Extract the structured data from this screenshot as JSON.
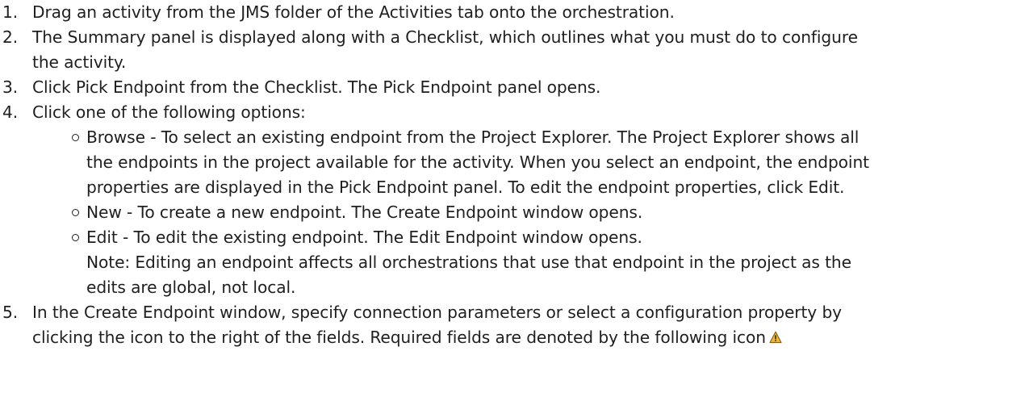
{
  "steps": [
    {
      "number": "1.",
      "text": "Drag an activity from the JMS folder of the Activities tab onto the orchestration."
    },
    {
      "number": "2.",
      "text_line1": "The Summary panel is displayed along with a Checklist, which outlines what you must do to configure",
      "text_line2": "the activity."
    },
    {
      "number": "3.",
      "text": "Click Pick Endpoint from the Checklist. The Pick Endpoint panel opens."
    },
    {
      "number": "4.",
      "text": "Click one of the following options:",
      "options": [
        {
          "line1": "Browse - To select an existing endpoint from the Project Explorer. The Project Explorer shows all",
          "line2": "the endpoints in the project available for the activity. When you select an endpoint, the endpoint",
          "line3": "properties are displayed in the Pick Endpoint panel. To edit the endpoint properties, click Edit."
        },
        {
          "line1": "New - To create a new endpoint. The Create Endpoint window opens."
        },
        {
          "line1": "Edit - To edit the existing endpoint. The Edit Endpoint window opens.",
          "note_line1": "Note: Editing an endpoint affects all orchestrations that use that endpoint in the project as the",
          "note_line2": "edits are global, not local."
        }
      ]
    },
    {
      "number": "5.",
      "text_line1": "In the Create Endpoint window, specify connection parameters or select a configuration property by",
      "text_line2": "clicking the icon to the right of the fields. Required fields are denoted by the following icon"
    }
  ],
  "icons": {
    "required_field": "warning-triangle-icon"
  },
  "colors": {
    "text": "#1f1f1f",
    "warning_fill": "#e8b93a",
    "warning_border": "#8a5a12"
  }
}
